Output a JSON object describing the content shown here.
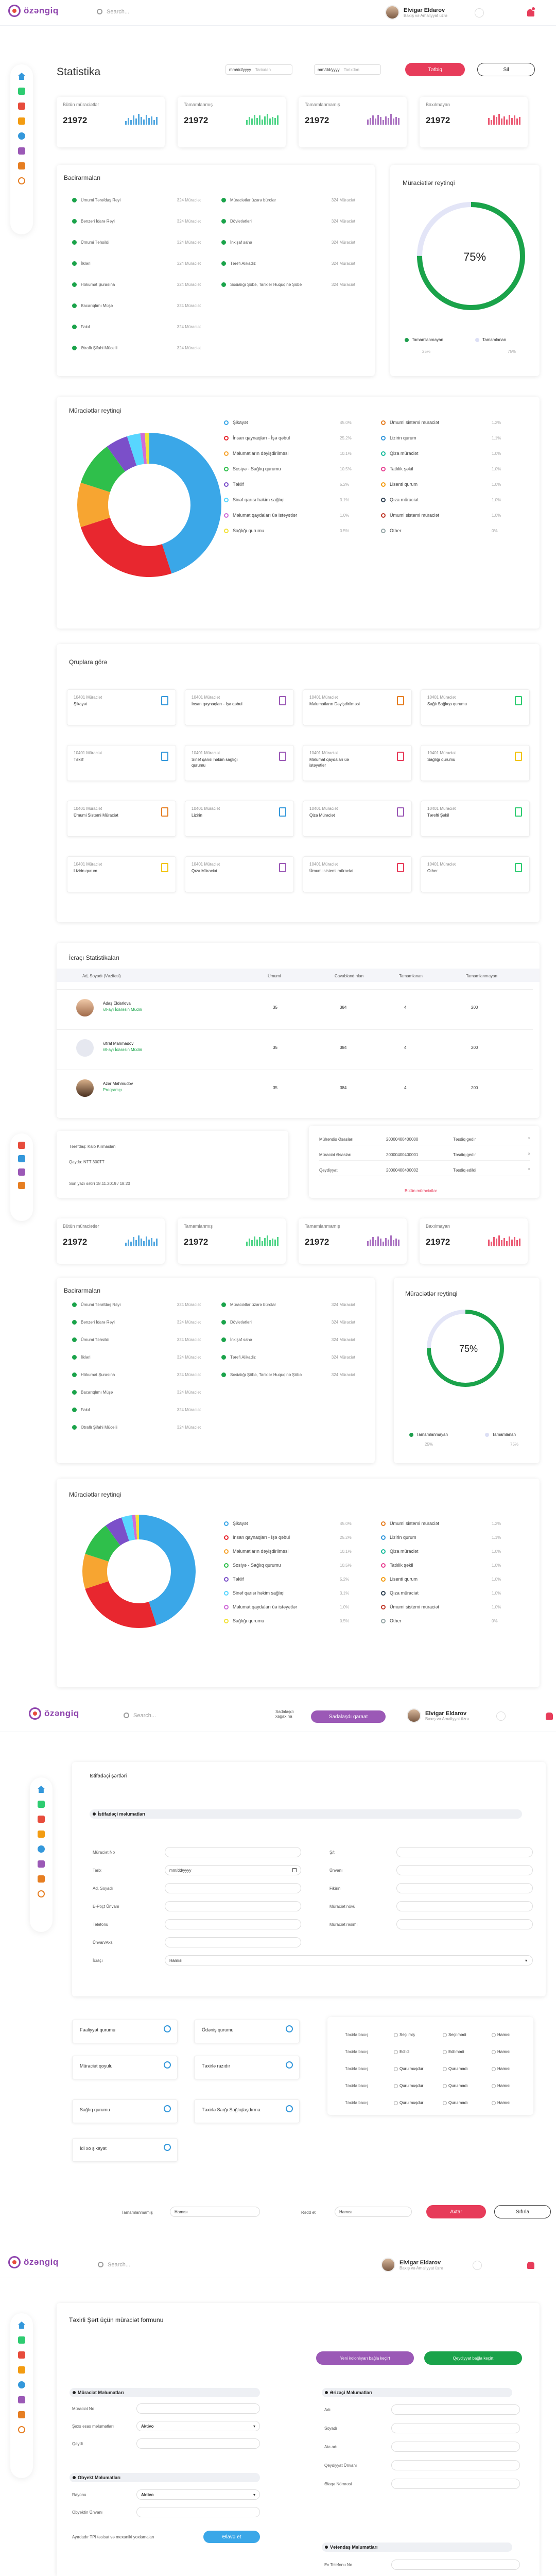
{
  "header": {
    "search_placeholder": "Search...",
    "user_name": "Elvigar Eldarov",
    "user_role": "Baxış və Amaliyyat üzrə"
  },
  "header2": {
    "link": "Sadalaşdı xagaxına",
    "add_button": "Sadalaşdı qaraat"
  },
  "stats": {
    "title": "Statistika",
    "date_placeholder": "mm/dd/yyyy",
    "date_to_label": "Tarixdən",
    "apply": "Tətbiq",
    "clear": "Sil"
  },
  "cards": [
    {
      "label": "Bütün müraciətlər",
      "value": "21972",
      "color": "#3498db",
      "spark": [
        5,
        9,
        6,
        12,
        8,
        14,
        10,
        7,
        13,
        9,
        11,
        6,
        10
      ]
    },
    {
      "label": "Tamamlanmış",
      "value": "21972",
      "color": "#2ecc71",
      "spark": [
        6,
        10,
        8,
        13,
        9,
        12,
        7,
        11,
        14,
        8,
        10,
        9,
        12
      ]
    },
    {
      "label": "Tamamlanmamış",
      "value": "21972",
      "color": "#9b59b6",
      "spark": [
        7,
        9,
        12,
        8,
        13,
        10,
        6,
        11,
        9,
        14,
        8,
        10,
        9
      ]
    },
    {
      "label": "Baxılmayan",
      "value": "21972",
      "color": "#e73c5a",
      "spark": [
        9,
        6,
        12,
        10,
        14,
        8,
        11,
        7,
        13,
        9,
        12,
        8,
        10
      ]
    }
  ],
  "depts": {
    "title": "Bacirarmaları",
    "left": [
      [
        "Ümumi Tərəfdaş Rəyi",
        "324 Müraciət"
      ],
      [
        "Bənzəri İdarə Rəyi",
        "324 Müraciət"
      ],
      [
        "Ümumi Təhsildi",
        "324 Müraciət"
      ],
      [
        "İlkləri",
        "324 Müraciət"
      ],
      [
        "Hökumət Şurasına",
        "324 Müraciət"
      ],
      [
        "Bacarıqlımı Müşə",
        "324 Müraciət"
      ],
      [
        "Fakıl",
        "324 Müraciət"
      ],
      [
        "Ətraflı Şifahi Mücelli",
        "324 Müraciət"
      ]
    ],
    "right": [
      [
        "Müraciətlər üzərə bürolar",
        "324 Müraciət"
      ],
      [
        "Dövlətlətləri",
        "324 Müraciət"
      ],
      [
        "İnkişaf sahə",
        "324 Müraciət"
      ],
      [
        "Tərefi Alikadiz",
        "324 Müraciət"
      ],
      [
        "Sosialığı Şöbə, Tarixlər Huquqinə Şöbə",
        "324 Müraciət"
      ]
    ]
  },
  "reytinq": {
    "title": "Müraciətlər reytinqi",
    "percent": 75,
    "percent_label": "75%",
    "legend": [
      {
        "label": "Tamamlanmayan",
        "value": "25%"
      },
      {
        "label": "Tamamlanan",
        "value": "75%"
      }
    ]
  },
  "donut": {
    "title": "Müraciətlər reytinqi",
    "items": [
      {
        "label": "Şikayət",
        "pct": "45.0%",
        "value": 45,
        "color": "#3aa7e8"
      },
      {
        "label": "İnsan qaynaqları - İşə qəbul",
        "pct": "25.2%",
        "value": 25,
        "color": "#e8272f"
      },
      {
        "label": "Məlumatların dəyişdirilməsi",
        "pct": "10.1%",
        "value": 10,
        "color": "#f7a531"
      },
      {
        "label": "Sosiyə - Sağlıq qurumu",
        "pct": "10.5%",
        "value": 10,
        "color": "#2fbf4b"
      },
      {
        "label": "Təklif",
        "pct": "5.2%",
        "value": 5,
        "color": "#7b4fc9"
      },
      {
        "label": "Sinəf qarısı həkim sağlıqi",
        "pct": "3.1%",
        "value": 3,
        "color": "#58d6ff"
      },
      {
        "label": "Məlumat qaydaları üə istəyətlər",
        "pct": "1.0%",
        "value": 1,
        "color": "#cf6bd8"
      },
      {
        "label": "Sağlığı qurumu",
        "pct": "0.5%",
        "value": 1,
        "color": "#f2e23a"
      }
    ],
    "items_right": [
      {
        "label": "Ümumi sistemi müraciət",
        "pct": "1.2%",
        "color": "#e67e22"
      },
      {
        "label": "Lizirin qurum",
        "pct": "1.1%",
        "color": "#3498db"
      },
      {
        "label": "Qiza müraciət",
        "pct": "1.0%",
        "color": "#1abc9c"
      },
      {
        "label": "Tatlılik şəkil",
        "pct": "1.0%",
        "color": "#e84393"
      },
      {
        "label": "Lisenti qurum",
        "pct": "1.0%",
        "color": "#f39c12"
      },
      {
        "label": "Qıza müraciət",
        "pct": "1.0%",
        "color": "#2c3e50"
      },
      {
        "label": "Ümumi sistemi müraciət",
        "pct": "1.0%",
        "color": "#c0392b"
      },
      {
        "label": "Other",
        "pct": "0%",
        "color": "#95a5a6"
      }
    ]
  },
  "groups": {
    "title": "Qruplara görə",
    "items": [
      {
        "n": "10401 Müraciət",
        "t": "Şikayət",
        "c": "#3498db"
      },
      {
        "n": "10401 Müraciət",
        "t": "İnsan qaynaqları - İşə qəbul",
        "c": "#9b59b6"
      },
      {
        "n": "10401 Müraciət",
        "t": "Məlumatların Dəyişdirilməsi",
        "c": "#e67e22"
      },
      {
        "n": "10401 Müraciət",
        "t": "Sağlı Sağlıqa qurumu",
        "c": "#2ecc71"
      },
      {
        "n": "10401 Müraciət",
        "t": "Təklif",
        "c": "#3498db"
      },
      {
        "n": "10401 Müraciət",
        "t": "Sinəf qarısı həkim sağlığı qurumu",
        "c": "#9b59b6"
      },
      {
        "n": "10401 Müraciət",
        "t": "Məlumat qaydaları üə istəyətlər",
        "c": "#e73c5a"
      },
      {
        "n": "10401 Müraciət",
        "t": "Sağlığı qurumu",
        "c": "#f1c40f"
      },
      {
        "n": "10401 Müraciət",
        "t": "Ümumi Sistemi Müraciət",
        "c": "#e67e22"
      },
      {
        "n": "10401 Müraciət",
        "t": "Lizirin",
        "c": "#3498db"
      },
      {
        "n": "10401 Müraciət",
        "t": "Qiza Müraciət",
        "c": "#9b59b6"
      },
      {
        "n": "10401 Müraciət",
        "t": "Tərefti Şəkil",
        "c": "#2ecc71"
      },
      {
        "n": "10401 Müraciət",
        "t": "Lizirin qurum",
        "c": "#f1c40f"
      },
      {
        "n": "10401 Müraciət",
        "t": "Qıza Müraciət",
        "c": "#9b59b6"
      },
      {
        "n": "10401 Müraciət",
        "t": "Ümumi sistemi müraciət",
        "c": "#e73c5a"
      },
      {
        "n": "10401 Müraciət",
        "t": "Other",
        "c": "#2ecc71"
      }
    ]
  },
  "executor": {
    "title": "İcraçı Statistikaları",
    "cols": [
      "Ad, Soyadı (Vəzifəsi)",
      "Ümumi",
      "Cavablandırılan",
      "Tamamlanan",
      "Tamamlanmayan"
    ],
    "rows": [
      {
        "name": "Adaş Eldarlova",
        "role": "Əl-ayı İdarəsin Müdiri",
        "a": "35",
        "b": "384",
        "c": "4",
        "d": "200"
      },
      {
        "name": "Ətraf Mahmadov",
        "role": "Əl-ayı İdarəsin Müdiri",
        "a": "35",
        "b": "384",
        "c": "4",
        "d": "200"
      },
      {
        "name": "Azər Mahmudov",
        "role": "Proqramçı",
        "a": "35",
        "b": "384",
        "c": "4",
        "d": "200"
      }
    ]
  },
  "overlap": {
    "row1_label": "Tərefdaş:",
    "row1_value": "Kalo Kırmaslan",
    "row2_label": "Qayda:",
    "row2_value": "NTT 300TT",
    "row3": "Son yazı sətiri 18.11.2019 / 18:20",
    "r_rows": [
      [
        "Mühəndis Əsasları",
        "20000400400000",
        "Təsdiq gedir"
      ],
      [
        "Müraciət Əsasları",
        "20000400400001",
        "Təsdiq gedir"
      ],
      [
        "Qeydiyyat",
        "20000400400002",
        "Təsdiq edildi"
      ]
    ],
    "more": "Bütün müraciətlər"
  },
  "form": {
    "title": "İstifadəçi şərtləri",
    "section": "İstifadəçi məlumatları",
    "left_labels": [
      "Müraciət No",
      "Tarix",
      "Ad, Soyadı",
      "E-Poçt Ünvanı",
      "Telefonu",
      "Ünvan/Aks",
      "İcraçı"
    ],
    "date_value": "mm/dd/yyyy",
    "right_labels": [
      "Ş/t",
      "Ünvanı",
      "Fikirin",
      "Müraciət növü",
      "Müraciət rəsimi"
    ],
    "select_value": "Hamısı",
    "checks": [
      "Fəaliyyət qurumu",
      "Ödəniş qurumu",
      "Müraciət qoyulu",
      "Təxirlə razıdır",
      "Sağlıq qurumu",
      "Təxirlə Sarğı Sağlıqlaşdırma",
      "İdi xo şikayət"
    ],
    "grid_rows": [
      "Təxirlə baxış",
      "Təxirlə baxış",
      "Təxirlə baxış",
      "Təxirlə baxış",
      "Təxirlə baxış"
    ],
    "grid_opts": [
      [
        "Seçilmiş",
        "Seçilmədi",
        "Hamısı"
      ],
      [
        "Edildi",
        "Edilmədi",
        "Hamısı"
      ],
      [
        "Qurulmuşdur",
        "Qurulmadı",
        "Hamısı"
      ],
      [
        "Qurulmuşdur",
        "Qurulmadı",
        "Hamısı"
      ],
      [
        "Qurulmuşdur",
        "Qurulmadı",
        "Hamısı"
      ]
    ],
    "bottom_l_label": "Tamamlanmamış",
    "bottom_r_label": "Rədd et",
    "bottom_select": "Hamısı",
    "apply": "Axtar",
    "clear": "Sıfırla"
  },
  "new": {
    "title": "Təxirli Şərt üçün müraciət formunu",
    "btn1": "Yeni kolonlıyarı bağla keçirt",
    "btn2": "Qeydiyyat bağla keçirt",
    "s1": "Müraciət Məlumatları",
    "s1_labels": [
      "Müraciət No",
      "Şəxs əsas məlumatları",
      "Qeydi"
    ],
    "s1_select": "Aktivo",
    "s2": "Obyekt Məlumatları",
    "s2_labels": [
      "Rayonu",
      "Obyektin Ünvanı"
    ],
    "s2_select": "Aktivo",
    "s2_note": "Ayırdadır TPI təsisat və mexaniki yoxlamaları",
    "s2_btn": "Əlavə et",
    "s3": "Ərizəçi Məlumatları",
    "s3_labels": [
      "Adı",
      "Soyadı",
      "Ata adı",
      "Qeydiyyat Ünvanı",
      "Əlaqə Nömrəsi"
    ],
    "s4": "Vətəndaş Məlumatları",
    "s4_labels": [
      "Ev Telefonu No"
    ]
  }
}
